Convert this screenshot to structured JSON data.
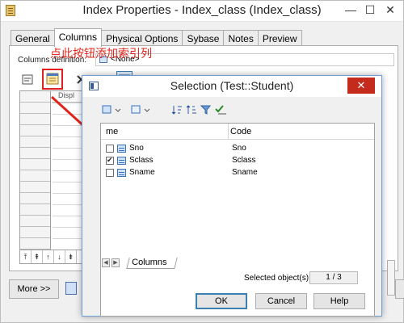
{
  "window": {
    "title": "Index Properties - Index_class (Index_class)",
    "min_glyph": "—",
    "max_glyph": "☐",
    "close_glyph": "✕"
  },
  "tabs": [
    {
      "label": "General"
    },
    {
      "label": "Columns",
      "active": true
    },
    {
      "label": "Physical Options"
    },
    {
      "label": "Sybase"
    },
    {
      "label": "Notes"
    },
    {
      "label": "Preview"
    }
  ],
  "column_definition": {
    "label": "Columns definition:",
    "value": "<None>"
  },
  "grid": {
    "column_header": "Displ"
  },
  "annotation": {
    "text": "点此按钮添加索引列",
    "color": "#e0241b"
  },
  "bottom": {
    "more_label": "More >>"
  },
  "dialog": {
    "title": "Selection (Test::Student)",
    "close_glyph": "✕",
    "list_headers": {
      "name": "me",
      "code": "Code"
    },
    "rows": [
      {
        "name": "Sno",
        "code": "Sno",
        "checked": false
      },
      {
        "name": "Sclass",
        "code": "Sclass",
        "checked": true
      },
      {
        "name": "Sname",
        "code": "Sname",
        "checked": false
      }
    ],
    "tab_label": "Columns",
    "selected_label": "Selected object(s):",
    "selected_count": "1 / 3",
    "buttons": {
      "ok": "OK",
      "cancel": "Cancel",
      "help": "Help"
    }
  }
}
